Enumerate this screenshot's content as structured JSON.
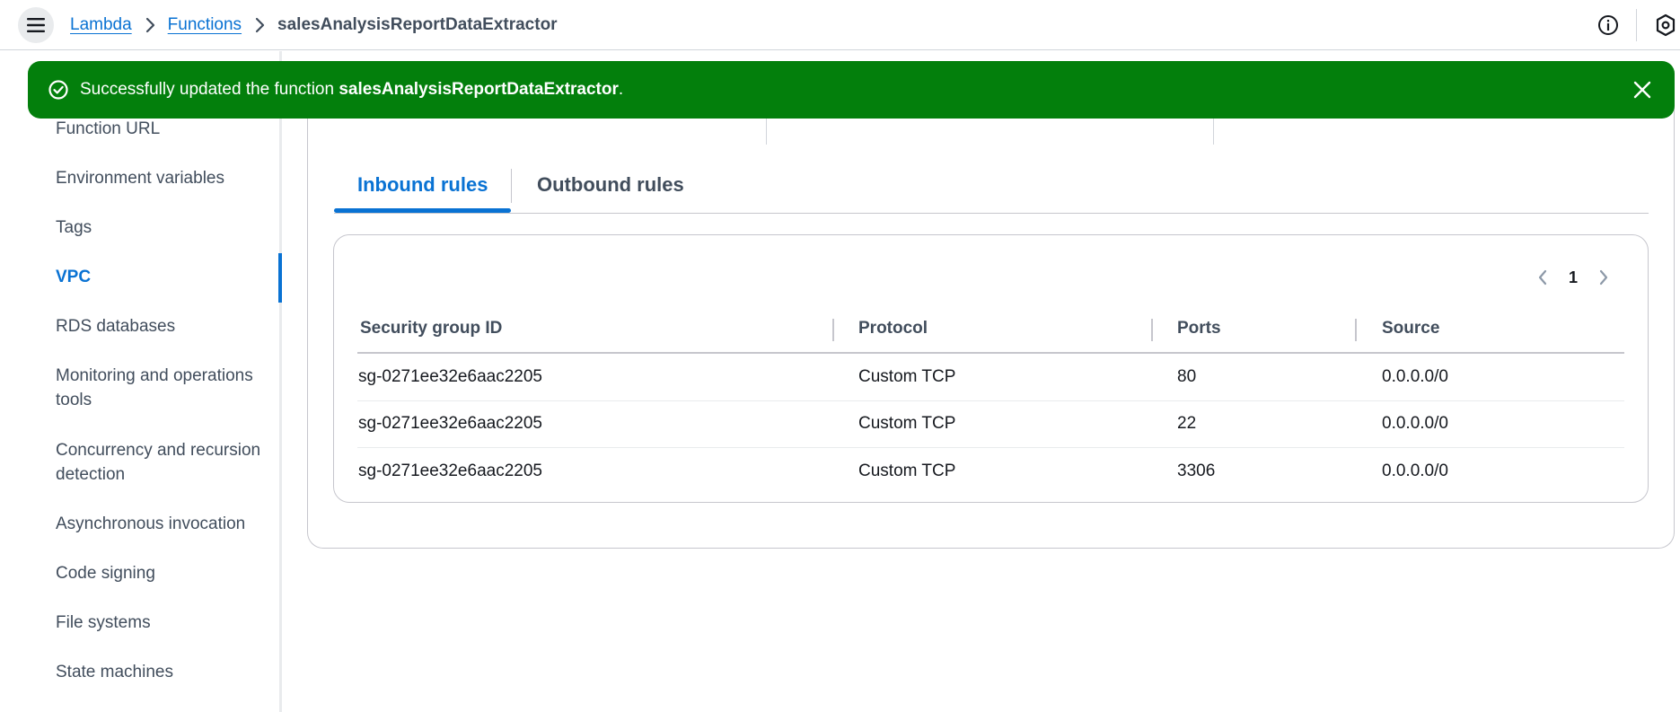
{
  "header": {
    "breadcrumbs": [
      {
        "label": "Lambda"
      },
      {
        "label": "Functions"
      },
      {
        "label": "salesAnalysisReportDataExtractor"
      }
    ],
    "icons": {
      "menu": "hamburger-menu-icon",
      "info": "info-icon",
      "settings": "hexagon-settings-icon"
    }
  },
  "flash": {
    "prefix": "Successfully updated the function ",
    "function_name": "salesAnalysisReportDataExtractor",
    "suffix": ".",
    "color": "#037f0c",
    "icons": {
      "status": "check-circle-icon",
      "dismiss": "close-icon"
    }
  },
  "sidebar": {
    "items": [
      {
        "label": "Function URL"
      },
      {
        "label": "Environment variables"
      },
      {
        "label": "Tags"
      },
      {
        "label": "VPC",
        "active": true
      },
      {
        "label": "RDS databases"
      },
      {
        "label": "Monitoring and operations tools"
      },
      {
        "label": "Concurrency and recursion detection"
      },
      {
        "label": "Asynchronous invocation"
      },
      {
        "label": "Code signing"
      },
      {
        "label": "File systems"
      },
      {
        "label": "State machines"
      }
    ]
  },
  "tabs": [
    {
      "label": "Inbound rules",
      "active": true
    },
    {
      "label": "Outbound rules",
      "active": false
    }
  ],
  "pagination": {
    "current_page": "1",
    "icons": {
      "prev": "chevron-left-icon",
      "next": "chevron-right-icon"
    }
  },
  "table": {
    "columns": [
      "Security group ID",
      "Protocol",
      "Ports",
      "Source"
    ],
    "rows": [
      [
        "sg-0271ee32e6aac2205",
        "Custom TCP",
        "80",
        "0.0.0.0/0"
      ],
      [
        "sg-0271ee32e6aac2205",
        "Custom TCP",
        "22",
        "0.0.0.0/0"
      ],
      [
        "sg-0271ee32e6aac2205",
        "Custom TCP",
        "3306",
        "0.0.0.0/0"
      ]
    ]
  },
  "colors": {
    "accent": "#0972d3",
    "success": "#037f0c",
    "text": "#16191f",
    "muted": "#414d5c"
  }
}
